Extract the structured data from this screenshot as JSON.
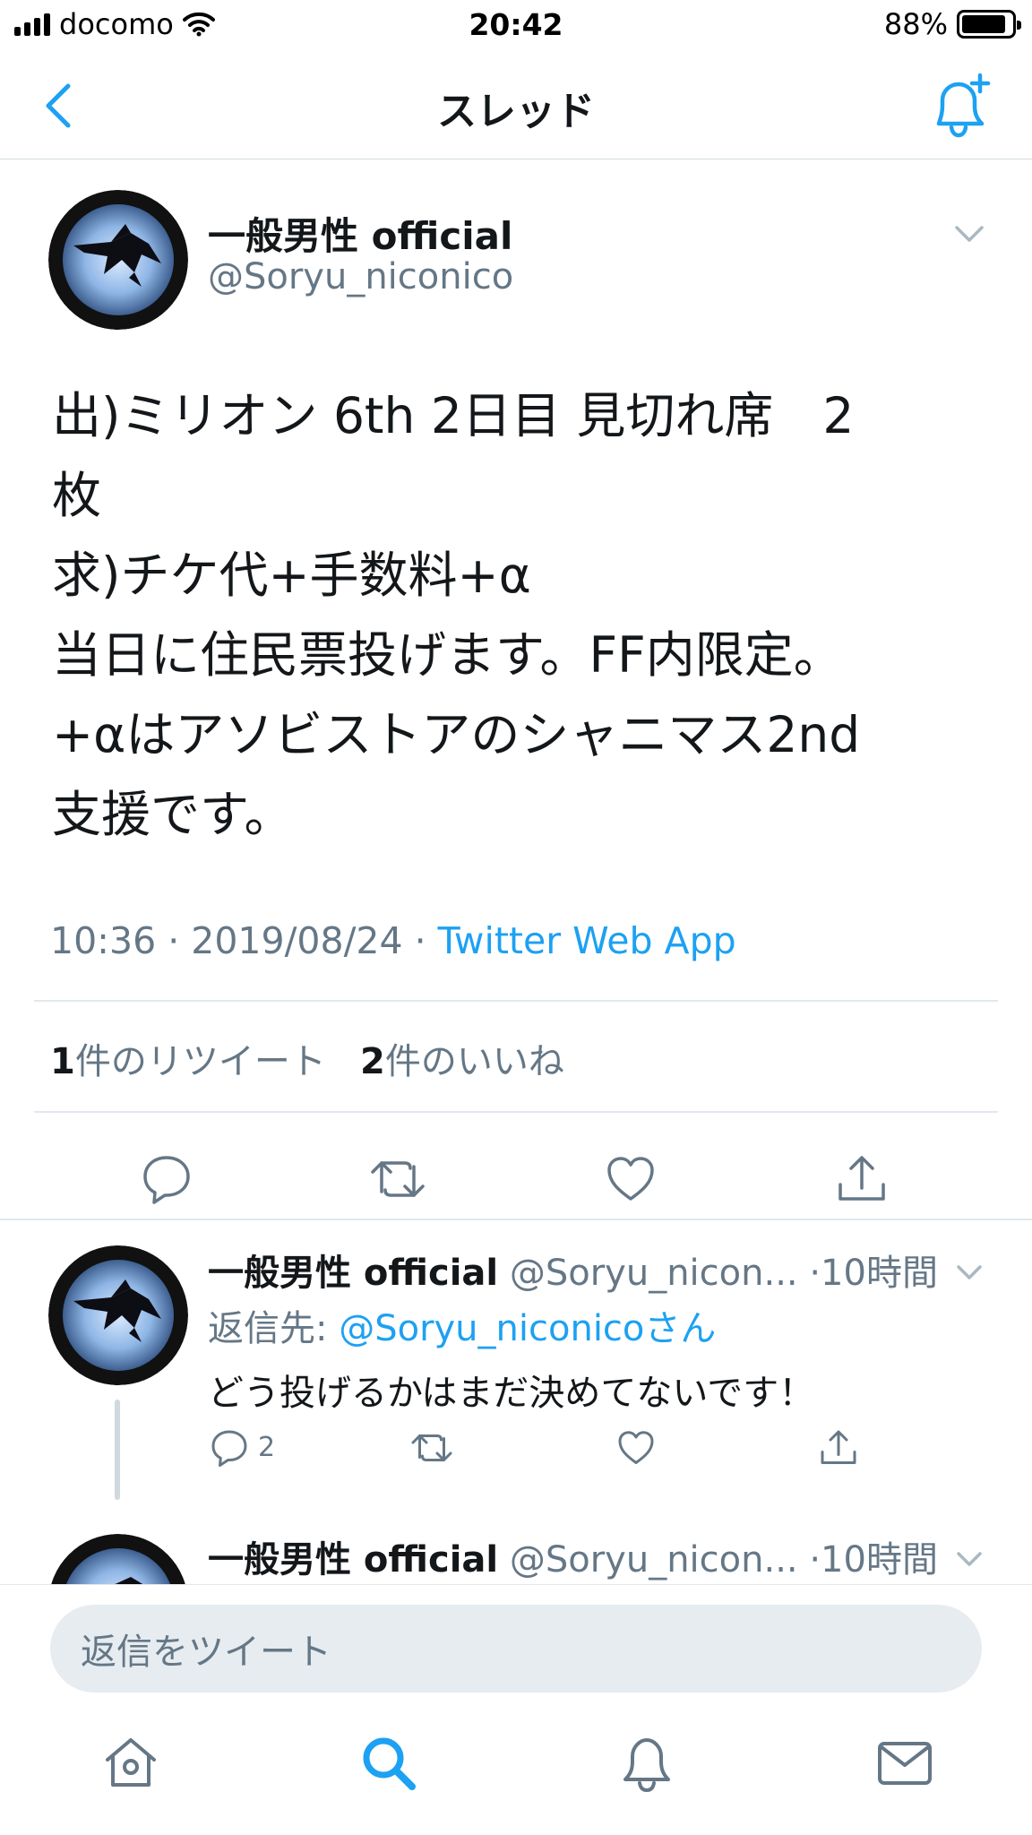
{
  "status_bar": {
    "carrier": "docomo",
    "time": "20:42",
    "battery_percent": "88%",
    "battery_level": 0.88
  },
  "nav": {
    "title": "スレッド",
    "back_icon": "chevron-left-icon",
    "right_icon": "bell-plus-icon",
    "accent_color": "#1da1f2"
  },
  "main_tweet": {
    "author_name": "一般男性 official",
    "author_handle": "@Soryu_niconico",
    "text_lines": [
      "出)ミリオン 6th 2日目 見切れ席　2",
      "枚",
      "求)チケ代+手数料+α",
      "当日に住民票投げます。FF内限定。",
      "+αはアソビストアのシャニマス2nd",
      "支援です。"
    ],
    "timestamp": "10:36 · 2019/08/24 · ",
    "via": "Twitter Web App",
    "retweet_count": "1",
    "retweet_label": "件のリツイート",
    "like_count": "2",
    "like_label": "件のいいね"
  },
  "replies": [
    {
      "author_name": "一般男性 official",
      "author_handle": "@Soryu_nicon...",
      "time": "·10時間",
      "reply_to_label": "返信先: ",
      "reply_to_mention": "@Soryu_niconicoさん",
      "text": "どう投げるかはまだ決めてないです！",
      "reply_count": "2"
    },
    {
      "author_name": "一般男性 official",
      "author_handle": "@Soryu_nicon...",
      "time": "·10時間"
    }
  ],
  "compose": {
    "placeholder": "返信をツイート"
  },
  "tabbar": {
    "items": [
      "home-icon",
      "search-icon",
      "notifications-icon",
      "messages-icon"
    ],
    "active": "search-icon"
  }
}
